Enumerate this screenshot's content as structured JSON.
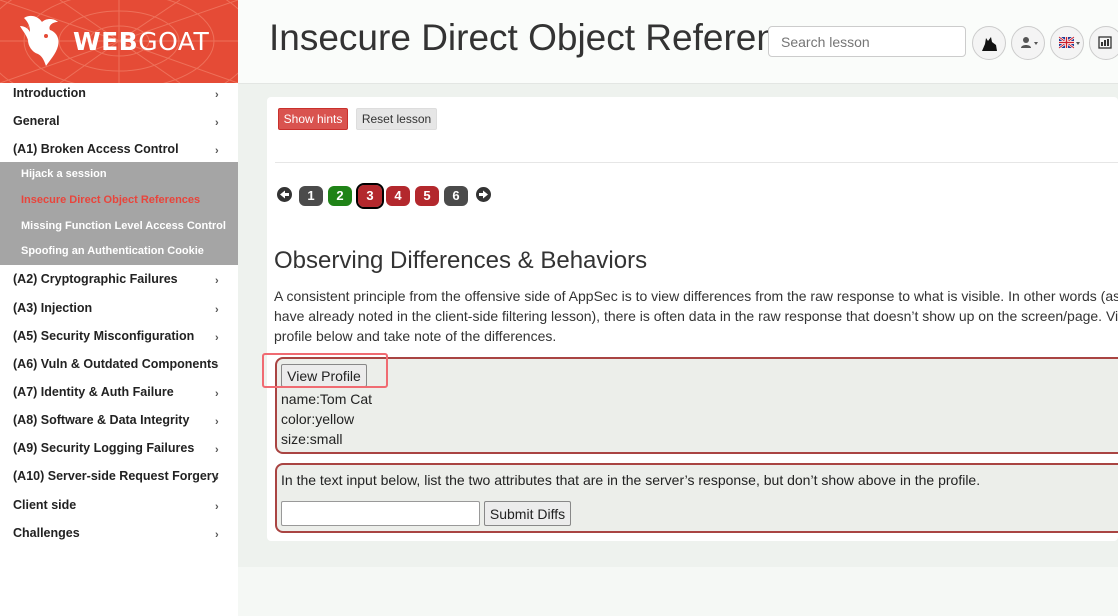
{
  "logo": {
    "text_bold": "WEB",
    "text_rest": "GOAT"
  },
  "header": {
    "title": "Insecure Direct Object Reference",
    "search_placeholder": "Search lesson"
  },
  "sidebar": {
    "items": [
      {
        "label": "Introduction"
      },
      {
        "label": "General"
      },
      {
        "label": "(A1) Broken Access Control"
      },
      {
        "label": "(A2) Cryptographic Failures"
      },
      {
        "label": "(A3) Injection"
      },
      {
        "label": "(A5) Security Misconfiguration"
      },
      {
        "label": "(A6) Vuln & Outdated Components"
      },
      {
        "label": "(A7) Identity & Auth Failure"
      },
      {
        "label": "(A8) Software & Data Integrity"
      },
      {
        "label": "(A9) Security Logging Failures"
      },
      {
        "label": "(A10) Server-side Request Forgery"
      },
      {
        "label": "Client side"
      },
      {
        "label": "Challenges"
      }
    ],
    "submenu": [
      {
        "label": "Hijack a session"
      },
      {
        "label": "Insecure Direct Object References"
      },
      {
        "label": "Missing Function Level Access Control"
      },
      {
        "label": "Spoofing an Authentication Cookie"
      }
    ],
    "chevron": "›"
  },
  "lesson": {
    "show_hints": "Show hints",
    "reset_lesson": "Reset lesson",
    "pages": [
      "1",
      "2",
      "3",
      "4",
      "5",
      "6"
    ],
    "current_page": "3",
    "section_title": "Observing Differences & Behaviors",
    "paragraph": [
      "A consistent principle from the offensive side of AppSec is to view differences from the raw response to what is visible. In other words (as you",
      "have already noted in the client-side filtering lesson), there is often data in the raw response that doesn’t show up on the screen/page. View the",
      "profile below and take note of the differences."
    ],
    "view_profile": "View Profile",
    "profile": {
      "name": "name:Tom Cat",
      "color": "color:yellow",
      "size": "size:small"
    },
    "instruction": "In the text input below, list the two attributes that are in the server’s response, but don’t show above in the profile.",
    "submit_diffs": "Submit Diffs"
  },
  "colors": {
    "brand": "#e54b36",
    "danger": "#d9534f",
    "page_green": "#1f8317",
    "page_red": "#b3282d",
    "page_grey": "#4b4b4b",
    "active_sub": "#e8453c"
  }
}
